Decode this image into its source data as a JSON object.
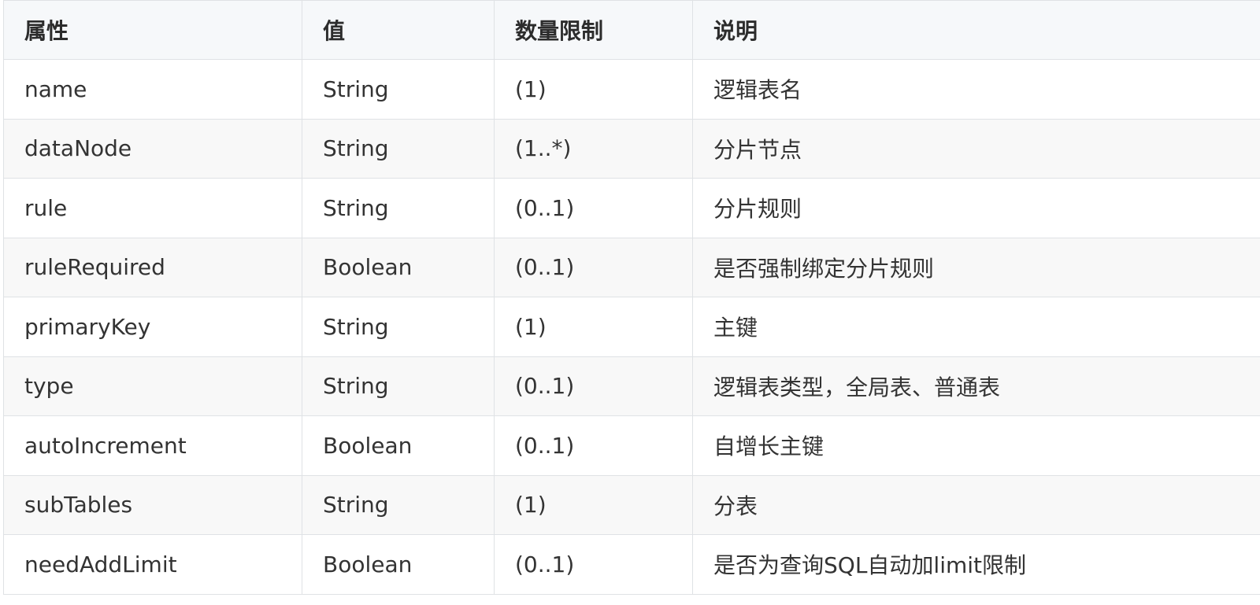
{
  "table": {
    "headers": [
      "属性",
      "值",
      "数量限制",
      "说明"
    ],
    "rows": [
      [
        "name",
        "String",
        "(1)",
        "逻辑表名"
      ],
      [
        "dataNode",
        "String",
        "(1..*)",
        "分片节点"
      ],
      [
        "rule",
        "String",
        "(0..1)",
        "分片规则"
      ],
      [
        "ruleRequired",
        "Boolean",
        "(0..1)",
        "是否强制绑定分片规则"
      ],
      [
        "primaryKey",
        "String",
        "(1)",
        "主键"
      ],
      [
        "type",
        "String",
        "(0..1)",
        "逻辑表类型，全局表、普通表"
      ],
      [
        "autoIncrement",
        "Boolean",
        "(0..1)",
        "自增长主键"
      ],
      [
        "subTables",
        "String",
        "(1)",
        "分表"
      ],
      [
        "needAddLimit",
        "Boolean",
        "(0..1)",
        "是否为查询SQL自动加limit限制"
      ]
    ]
  },
  "colors": {
    "border": "#dfe2e5",
    "header_bg": "#f6f8fa",
    "row_alt_bg": "#f8f8f8",
    "text": "#333333"
  }
}
